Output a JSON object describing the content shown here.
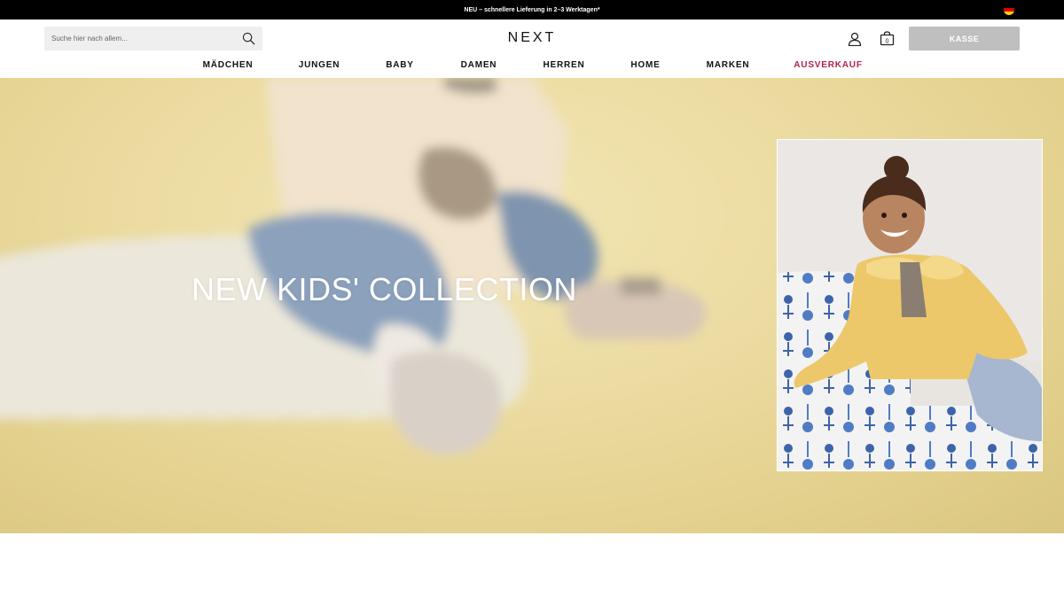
{
  "promo": {
    "text": "NEU – schnellere Lieferung in 2–3 Werktagen*",
    "flag_icon": "germany-flag-icon"
  },
  "header": {
    "search_placeholder": "Suche hier nach allem...",
    "search_icon": "search-icon",
    "logo": "NEXT",
    "account_icon": "account-icon",
    "bag_icon": "shopping-bag-icon",
    "bag_count": "0",
    "checkout_label": "KASSE"
  },
  "nav": {
    "items": [
      {
        "label": "MÄDCHEN"
      },
      {
        "label": "JUNGEN"
      },
      {
        "label": "BABY"
      },
      {
        "label": "DAMEN"
      },
      {
        "label": "HERREN"
      },
      {
        "label": "HOME"
      },
      {
        "label": "MARKEN"
      },
      {
        "label": "AUSVERKAUF"
      }
    ]
  },
  "hero": {
    "title": "NEW KIDS' COLLECTION"
  },
  "colors": {
    "sale": "#b4204e",
    "checkout_button": "#bfbfbf",
    "promo_bar": "#000000",
    "hero_background": "#ecdca2"
  }
}
